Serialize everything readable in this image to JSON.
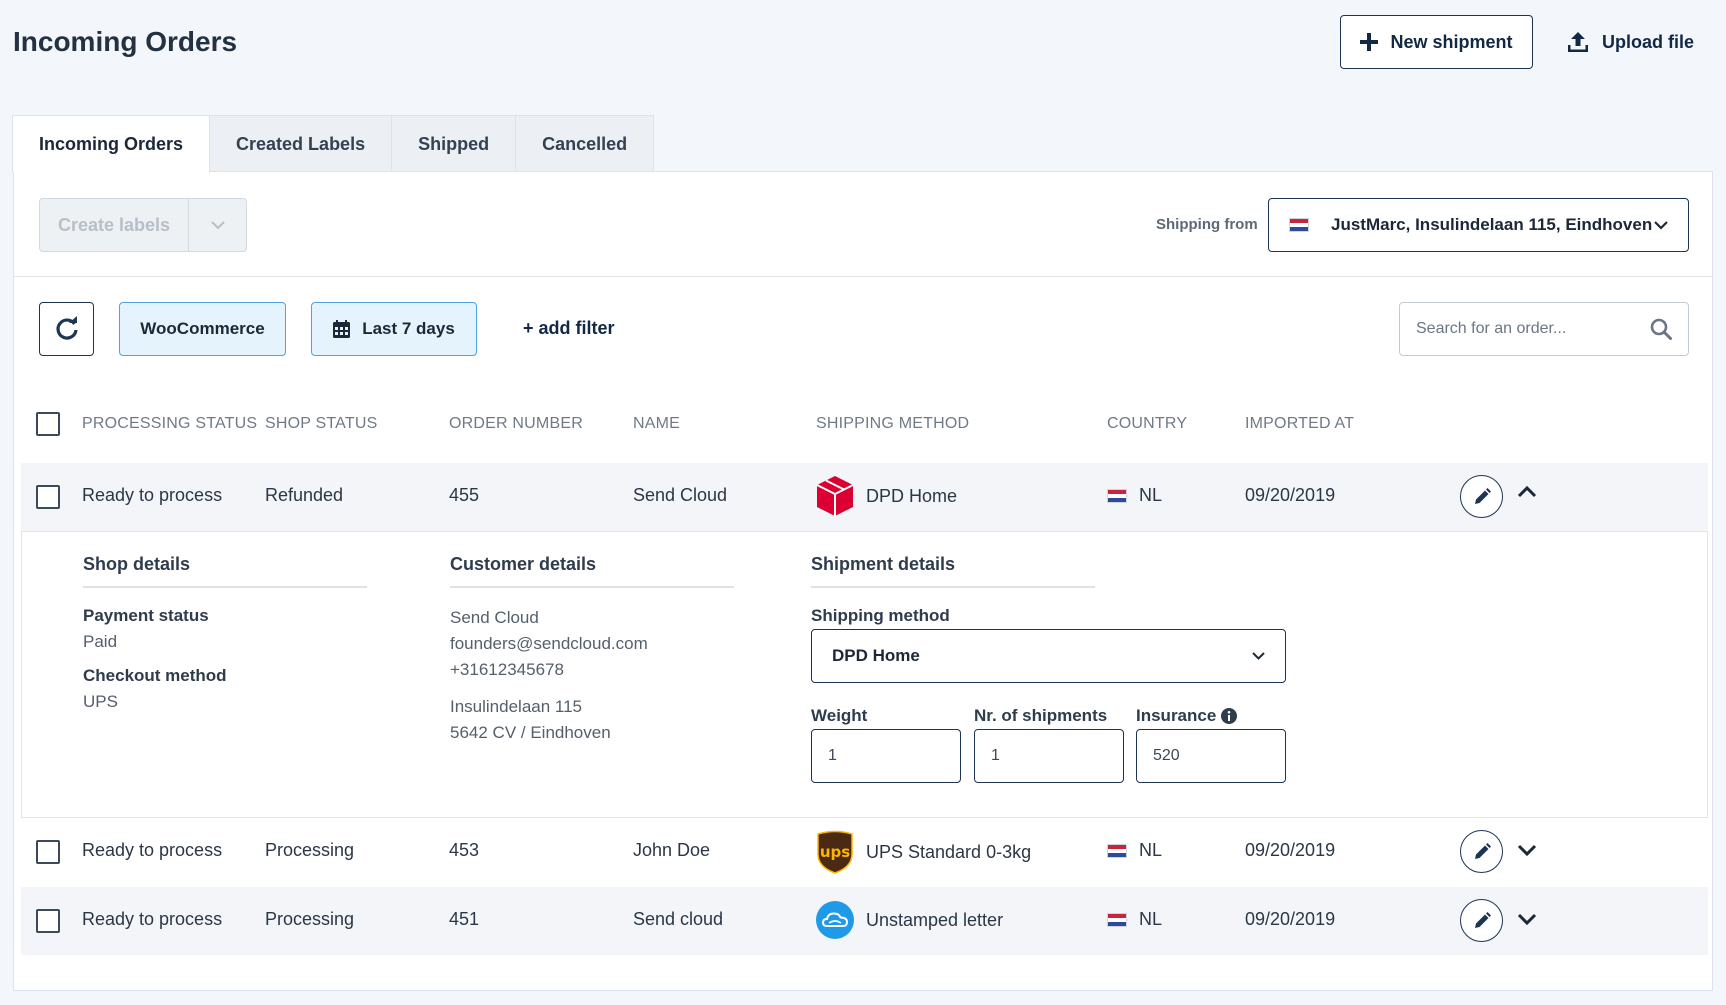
{
  "page": {
    "title": "Incoming Orders",
    "new_shipment_label": "New shipment",
    "upload_file_label": "Upload file"
  },
  "tabs": [
    {
      "label": "Incoming Orders",
      "active": true
    },
    {
      "label": "Created Labels",
      "active": false
    },
    {
      "label": "Shipped",
      "active": false
    },
    {
      "label": "Cancelled",
      "active": false
    }
  ],
  "toolbar": {
    "create_labels_label": "Create labels",
    "shipping_from_label": "Shipping from",
    "shipping_from_value": "JustMarc, Insulindelaan 115, Eindhoven"
  },
  "filters": {
    "shop_chip": "WooCommerce",
    "date_chip": "Last 7 days",
    "add_filter": "+ add filter",
    "search_placeholder": "Search for an order..."
  },
  "table": {
    "headers": [
      "PROCESSING STATUS",
      "SHOP STATUS",
      "ORDER NUMBER",
      "NAME",
      "SHIPPING METHOD",
      "COUNTRY",
      "IMPORTED AT"
    ],
    "rows": [
      {
        "processing_status": "Ready to process",
        "shop_status": "Refunded",
        "order_number": "455",
        "name": "Send Cloud",
        "shipping_method": "DPD Home",
        "carrier_icon": "dpd-icon",
        "country": "NL",
        "imported_at": "09/20/2019",
        "expanded": true
      },
      {
        "processing_status": "Ready to process",
        "shop_status": "Processing",
        "order_number": "453",
        "name": "John Doe",
        "shipping_method": "UPS Standard 0-3kg",
        "carrier_icon": "ups-icon",
        "country": "NL",
        "imported_at": "09/20/2019",
        "expanded": false
      },
      {
        "processing_status": "Ready to process",
        "shop_status": "Processing",
        "order_number": "451",
        "name": "Send cloud",
        "shipping_method": "Unstamped letter",
        "carrier_icon": "sendcloud-icon",
        "country": "NL",
        "imported_at": "09/20/2019",
        "expanded": false
      }
    ]
  },
  "details": {
    "shop": {
      "title": "Shop details",
      "payment_status_label": "Payment status",
      "payment_status": "Paid",
      "checkout_method_label": "Checkout method",
      "checkout_method": "UPS"
    },
    "customer": {
      "title": "Customer details",
      "name": "Send Cloud",
      "email": "founders@sendcloud.com",
      "phone": "+31612345678",
      "street": "Insulindelaan 115",
      "city": "5642 CV / Eindhoven"
    },
    "shipment": {
      "title": "Shipment details",
      "shipping_method_label": "Shipping method",
      "shipping_method": "DPD Home",
      "weight_label": "Weight",
      "weight": "1",
      "nr_shipments_label": "Nr. of shipments",
      "nr_shipments": "1",
      "insurance_label": "Insurance",
      "insurance": "520"
    }
  },
  "colors": {
    "primary": "#1d3553",
    "chip_bg": "#e5f3fd",
    "chip_border": "#4fa3e0",
    "dpd_red": "#dc0032",
    "ups_brown": "#4b2a14",
    "ups_gold": "#ffb500",
    "sendcloud_blue": "#1e9ae8"
  }
}
